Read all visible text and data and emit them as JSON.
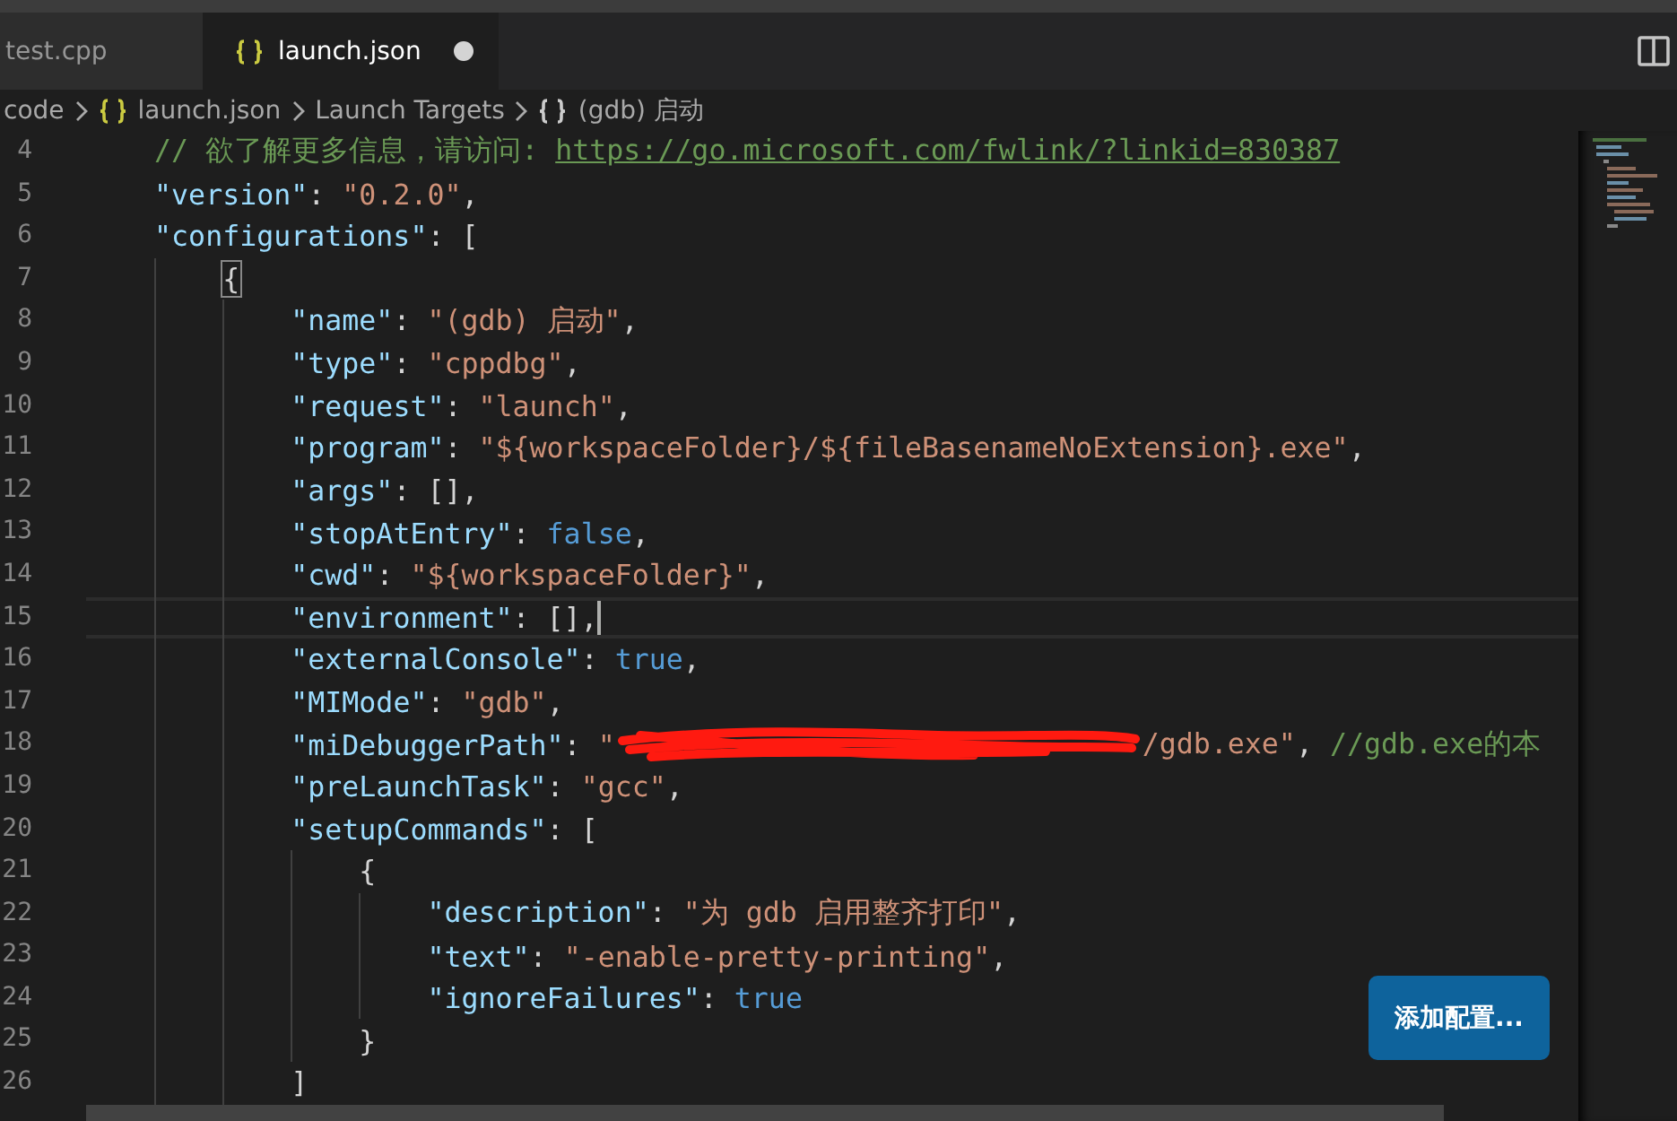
{
  "tabs": [
    {
      "label": "test.cpp",
      "selected": false,
      "icon": false,
      "dirty": false
    },
    {
      "label": "launch.json",
      "selected": true,
      "icon": true,
      "dirty": true
    }
  ],
  "breadcrumb": [
    {
      "label": "code",
      "kind": "plain"
    },
    {
      "label": "launch.json",
      "kind": "file"
    },
    {
      "label": "Launch Targets",
      "kind": "plain"
    },
    {
      "label": "(gdb) 启动",
      "kind": "symbol"
    }
  ],
  "lines": [
    {
      "number": "4",
      "current": false,
      "cursor": false,
      "tokens": [
        {
          "kind": "comment",
          "text": "// 欲了解更多信息，请访问: "
        },
        {
          "kind": "link",
          "text": "https://go.microsoft.com/fwlink/?linkid=830387"
        }
      ]
    },
    {
      "number": "5",
      "current": false,
      "cursor": false,
      "tokens": [
        {
          "kind": "key",
          "text": "\"version\""
        },
        {
          "kind": "punct",
          "text": ": "
        },
        {
          "kind": "str",
          "text": "\"0.2.0\""
        },
        {
          "kind": "punct",
          "text": ","
        }
      ]
    },
    {
      "number": "6",
      "current": false,
      "cursor": false,
      "tokens": [
        {
          "kind": "key",
          "text": "\"configurations\""
        },
        {
          "kind": "punct",
          "text": ": ["
        }
      ],
      "children": [
        {
          "number": "7",
          "current": false,
          "cursor": false,
          "tokens": [
            {
              "kind": "punct",
              "text": "{",
              "boxed": true
            }
          ],
          "children": [
            {
              "number": "8",
              "current": false,
              "cursor": false,
              "tokens": [
                {
                  "kind": "key",
                  "text": "\"name\""
                },
                {
                  "kind": "punct",
                  "text": ": "
                },
                {
                  "kind": "str",
                  "text": "\"(gdb) 启动\""
                },
                {
                  "kind": "punct",
                  "text": ","
                }
              ]
            },
            {
              "number": "9",
              "current": false,
              "cursor": false,
              "tokens": [
                {
                  "kind": "key",
                  "text": "\"type\""
                },
                {
                  "kind": "punct",
                  "text": ": "
                },
                {
                  "kind": "str",
                  "text": "\"cppdbg\""
                },
                {
                  "kind": "punct",
                  "text": ","
                }
              ]
            },
            {
              "number": "10",
              "current": false,
              "cursor": false,
              "tokens": [
                {
                  "kind": "key",
                  "text": "\"request\""
                },
                {
                  "kind": "punct",
                  "text": ": "
                },
                {
                  "kind": "str",
                  "text": "\"launch\""
                },
                {
                  "kind": "punct",
                  "text": ","
                }
              ]
            },
            {
              "number": "11",
              "current": false,
              "cursor": false,
              "tokens": [
                {
                  "kind": "key",
                  "text": "\"program\""
                },
                {
                  "kind": "punct",
                  "text": ": "
                },
                {
                  "kind": "str",
                  "text": "\"${workspaceFolder}/${fileBasenameNoExtension}.exe\""
                },
                {
                  "kind": "punct",
                  "text": ","
                }
              ]
            },
            {
              "number": "12",
              "current": false,
              "cursor": false,
              "tokens": [
                {
                  "kind": "key",
                  "text": "\"args\""
                },
                {
                  "kind": "punct",
                  "text": ": [],"
                }
              ]
            },
            {
              "number": "13",
              "current": false,
              "cursor": false,
              "tokens": [
                {
                  "kind": "key",
                  "text": "\"stopAtEntry\""
                },
                {
                  "kind": "punct",
                  "text": ": "
                },
                {
                  "kind": "bool",
                  "text": "false"
                },
                {
                  "kind": "punct",
                  "text": ","
                }
              ]
            },
            {
              "number": "14",
              "current": false,
              "cursor": false,
              "tokens": [
                {
                  "kind": "key",
                  "text": "\"cwd\""
                },
                {
                  "kind": "punct",
                  "text": ": "
                },
                {
                  "kind": "str",
                  "text": "\"${workspaceFolder}\""
                },
                {
                  "kind": "punct",
                  "text": ","
                }
              ]
            },
            {
              "number": "15",
              "current": true,
              "cursor": true,
              "tokens": [
                {
                  "kind": "key",
                  "text": "\"environment\""
                },
                {
                  "kind": "punct",
                  "text": ": [],"
                }
              ]
            },
            {
              "number": "16",
              "current": false,
              "cursor": false,
              "tokens": [
                {
                  "kind": "key",
                  "text": "\"externalConsole\""
                },
                {
                  "kind": "punct",
                  "text": ": "
                },
                {
                  "kind": "bool",
                  "text": "true"
                },
                {
                  "kind": "punct",
                  "text": ","
                }
              ]
            },
            {
              "number": "17",
              "current": false,
              "cursor": false,
              "tokens": [
                {
                  "kind": "key",
                  "text": "\"MIMode\""
                },
                {
                  "kind": "punct",
                  "text": ": "
                },
                {
                  "kind": "str",
                  "text": "\"gdb\""
                },
                {
                  "kind": "punct",
                  "text": ","
                }
              ]
            },
            {
              "number": "18",
              "current": false,
              "cursor": false,
              "tokens": [
                {
                  "kind": "key",
                  "text": "\"miDebuggerPath\""
                },
                {
                  "kind": "punct",
                  "text": ": "
                },
                {
                  "kind": "str",
                  "text": "\""
                },
                {
                  "kind": "redaction"
                },
                {
                  "kind": "str",
                  "text": "/gdb.exe\""
                },
                {
                  "kind": "punct",
                  "text": ", "
                },
                {
                  "kind": "comment",
                  "text": "//gdb.exe的本"
                }
              ]
            },
            {
              "number": "19",
              "current": false,
              "cursor": false,
              "tokens": [
                {
                  "kind": "key",
                  "text": "\"preLaunchTask\""
                },
                {
                  "kind": "punct",
                  "text": ": "
                },
                {
                  "kind": "str",
                  "text": "\"gcc\""
                },
                {
                  "kind": "punct",
                  "text": ","
                }
              ]
            },
            {
              "number": "20",
              "current": false,
              "cursor": false,
              "tokens": [
                {
                  "kind": "key",
                  "text": "\"setupCommands\""
                },
                {
                  "kind": "punct",
                  "text": ": ["
                }
              ],
              "children": [
                {
                  "number": "21",
                  "current": false,
                  "cursor": false,
                  "tokens": [
                    {
                      "kind": "punct",
                      "text": "{"
                    }
                  ],
                  "children": [
                    {
                      "number": "22",
                      "current": false,
                      "cursor": false,
                      "tokens": [
                        {
                          "kind": "key",
                          "text": "\"description\""
                        },
                        {
                          "kind": "punct",
                          "text": ": "
                        },
                        {
                          "kind": "str",
                          "text": "\"为 gdb 启用整齐打印\""
                        },
                        {
                          "kind": "punct",
                          "text": ","
                        }
                      ]
                    },
                    {
                      "number": "23",
                      "current": false,
                      "cursor": false,
                      "tokens": [
                        {
                          "kind": "key",
                          "text": "\"text\""
                        },
                        {
                          "kind": "punct",
                          "text": ": "
                        },
                        {
                          "kind": "str",
                          "text": "\"-enable-pretty-printing\""
                        },
                        {
                          "kind": "punct",
                          "text": ","
                        }
                      ]
                    },
                    {
                      "number": "24",
                      "current": false,
                      "cursor": false,
                      "tokens": [
                        {
                          "kind": "key",
                          "text": "\"ignoreFailures\""
                        },
                        {
                          "kind": "punct",
                          "text": ": "
                        },
                        {
                          "kind": "bool",
                          "text": "true"
                        }
                      ]
                    }
                  ]
                },
                {
                  "number": "25",
                  "current": false,
                  "cursor": false,
                  "tokens": [
                    {
                      "kind": "punct",
                      "text": "}"
                    }
                  ]
                }
              ]
            },
            {
              "number": "26",
              "current": false,
              "cursor": false,
              "tokens": [
                {
                  "kind": "punct",
                  "text": "]"
                }
              ]
            }
          ]
        }
      ]
    }
  ],
  "button": {
    "label": "添加配置..."
  }
}
